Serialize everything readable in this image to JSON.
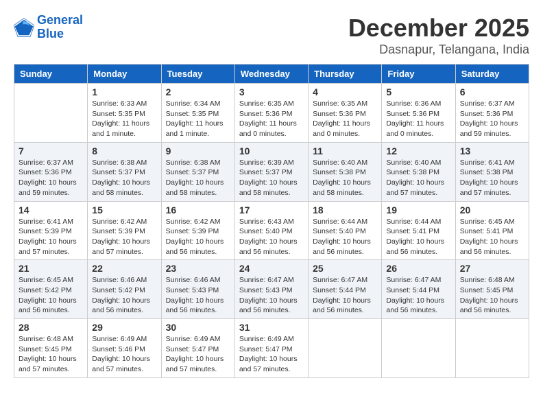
{
  "logo": {
    "line1": "General",
    "line2": "Blue"
  },
  "title": "December 2025",
  "subtitle": "Dasnapur, Telangana, India",
  "days_of_week": [
    "Sunday",
    "Monday",
    "Tuesday",
    "Wednesday",
    "Thursday",
    "Friday",
    "Saturday"
  ],
  "weeks": [
    [
      {
        "day": "",
        "info": ""
      },
      {
        "day": "1",
        "info": "Sunrise: 6:33 AM\nSunset: 5:35 PM\nDaylight: 11 hours\nand 1 minute."
      },
      {
        "day": "2",
        "info": "Sunrise: 6:34 AM\nSunset: 5:35 PM\nDaylight: 11 hours\nand 1 minute."
      },
      {
        "day": "3",
        "info": "Sunrise: 6:35 AM\nSunset: 5:36 PM\nDaylight: 11 hours\nand 0 minutes."
      },
      {
        "day": "4",
        "info": "Sunrise: 6:35 AM\nSunset: 5:36 PM\nDaylight: 11 hours\nand 0 minutes."
      },
      {
        "day": "5",
        "info": "Sunrise: 6:36 AM\nSunset: 5:36 PM\nDaylight: 11 hours\nand 0 minutes."
      },
      {
        "day": "6",
        "info": "Sunrise: 6:37 AM\nSunset: 5:36 PM\nDaylight: 10 hours\nand 59 minutes."
      }
    ],
    [
      {
        "day": "7",
        "info": "Sunrise: 6:37 AM\nSunset: 5:36 PM\nDaylight: 10 hours\nand 59 minutes."
      },
      {
        "day": "8",
        "info": "Sunrise: 6:38 AM\nSunset: 5:37 PM\nDaylight: 10 hours\nand 58 minutes."
      },
      {
        "day": "9",
        "info": "Sunrise: 6:38 AM\nSunset: 5:37 PM\nDaylight: 10 hours\nand 58 minutes."
      },
      {
        "day": "10",
        "info": "Sunrise: 6:39 AM\nSunset: 5:37 PM\nDaylight: 10 hours\nand 58 minutes."
      },
      {
        "day": "11",
        "info": "Sunrise: 6:40 AM\nSunset: 5:38 PM\nDaylight: 10 hours\nand 58 minutes."
      },
      {
        "day": "12",
        "info": "Sunrise: 6:40 AM\nSunset: 5:38 PM\nDaylight: 10 hours\nand 57 minutes."
      },
      {
        "day": "13",
        "info": "Sunrise: 6:41 AM\nSunset: 5:38 PM\nDaylight: 10 hours\nand 57 minutes."
      }
    ],
    [
      {
        "day": "14",
        "info": "Sunrise: 6:41 AM\nSunset: 5:39 PM\nDaylight: 10 hours\nand 57 minutes."
      },
      {
        "day": "15",
        "info": "Sunrise: 6:42 AM\nSunset: 5:39 PM\nDaylight: 10 hours\nand 57 minutes."
      },
      {
        "day": "16",
        "info": "Sunrise: 6:42 AM\nSunset: 5:39 PM\nDaylight: 10 hours\nand 56 minutes."
      },
      {
        "day": "17",
        "info": "Sunrise: 6:43 AM\nSunset: 5:40 PM\nDaylight: 10 hours\nand 56 minutes."
      },
      {
        "day": "18",
        "info": "Sunrise: 6:44 AM\nSunset: 5:40 PM\nDaylight: 10 hours\nand 56 minutes."
      },
      {
        "day": "19",
        "info": "Sunrise: 6:44 AM\nSunset: 5:41 PM\nDaylight: 10 hours\nand 56 minutes."
      },
      {
        "day": "20",
        "info": "Sunrise: 6:45 AM\nSunset: 5:41 PM\nDaylight: 10 hours\nand 56 minutes."
      }
    ],
    [
      {
        "day": "21",
        "info": "Sunrise: 6:45 AM\nSunset: 5:42 PM\nDaylight: 10 hours\nand 56 minutes."
      },
      {
        "day": "22",
        "info": "Sunrise: 6:46 AM\nSunset: 5:42 PM\nDaylight: 10 hours\nand 56 minutes."
      },
      {
        "day": "23",
        "info": "Sunrise: 6:46 AM\nSunset: 5:43 PM\nDaylight: 10 hours\nand 56 minutes."
      },
      {
        "day": "24",
        "info": "Sunrise: 6:47 AM\nSunset: 5:43 PM\nDaylight: 10 hours\nand 56 minutes."
      },
      {
        "day": "25",
        "info": "Sunrise: 6:47 AM\nSunset: 5:44 PM\nDaylight: 10 hours\nand 56 minutes."
      },
      {
        "day": "26",
        "info": "Sunrise: 6:47 AM\nSunset: 5:44 PM\nDaylight: 10 hours\nand 56 minutes."
      },
      {
        "day": "27",
        "info": "Sunrise: 6:48 AM\nSunset: 5:45 PM\nDaylight: 10 hours\nand 56 minutes."
      }
    ],
    [
      {
        "day": "28",
        "info": "Sunrise: 6:48 AM\nSunset: 5:45 PM\nDaylight: 10 hours\nand 57 minutes."
      },
      {
        "day": "29",
        "info": "Sunrise: 6:49 AM\nSunset: 5:46 PM\nDaylight: 10 hours\nand 57 minutes."
      },
      {
        "day": "30",
        "info": "Sunrise: 6:49 AM\nSunset: 5:47 PM\nDaylight: 10 hours\nand 57 minutes."
      },
      {
        "day": "31",
        "info": "Sunrise: 6:49 AM\nSunset: 5:47 PM\nDaylight: 10 hours\nand 57 minutes."
      },
      {
        "day": "",
        "info": ""
      },
      {
        "day": "",
        "info": ""
      },
      {
        "day": "",
        "info": ""
      }
    ]
  ]
}
